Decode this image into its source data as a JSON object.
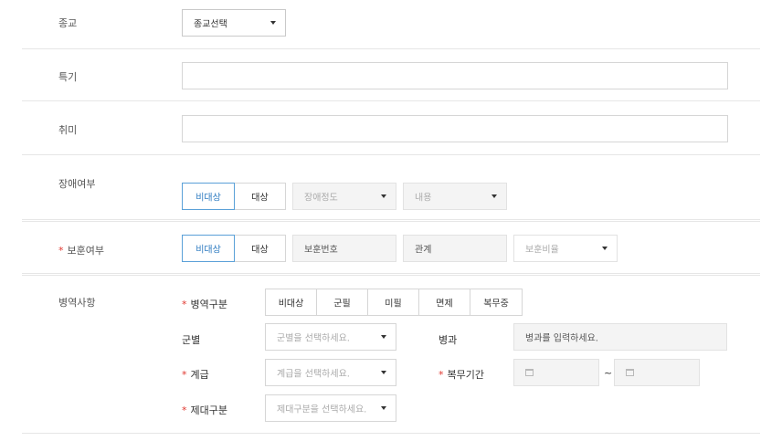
{
  "religion": {
    "label": "종교",
    "select_value": "종교선택"
  },
  "specialty": {
    "label": "특기",
    "value": ""
  },
  "hobby": {
    "label": "취미",
    "value": ""
  },
  "disability": {
    "label": "장애여부",
    "options": [
      "비대상",
      "대상"
    ],
    "selected": "비대상",
    "grade_placeholder": "장애정도",
    "content_placeholder": "내용"
  },
  "veteran": {
    "required_mark": "*",
    "label": "보훈여부",
    "options": [
      "비대상",
      "대상"
    ],
    "selected": "비대상",
    "number_placeholder": "보훈번호",
    "relation_placeholder": "관계",
    "ratio_placeholder": "보훈비율"
  },
  "military": {
    "label": "병역사항",
    "required_mark": "*",
    "type_label": "병역구분",
    "type_options": [
      "비대상",
      "군필",
      "미필",
      "면제",
      "복무중"
    ],
    "branch_label": "군별",
    "branch_placeholder": "군별을 선택하세요.",
    "specialty_label": "병과",
    "specialty_placeholder": "병과를 입력하세요.",
    "rank_label": "계급",
    "rank_placeholder": "계급을 선택하세요.",
    "period_label": "복무기간",
    "period_separator": "~",
    "discharge_label": "제대구분",
    "discharge_placeholder": "제대구분을 선택하세요."
  }
}
